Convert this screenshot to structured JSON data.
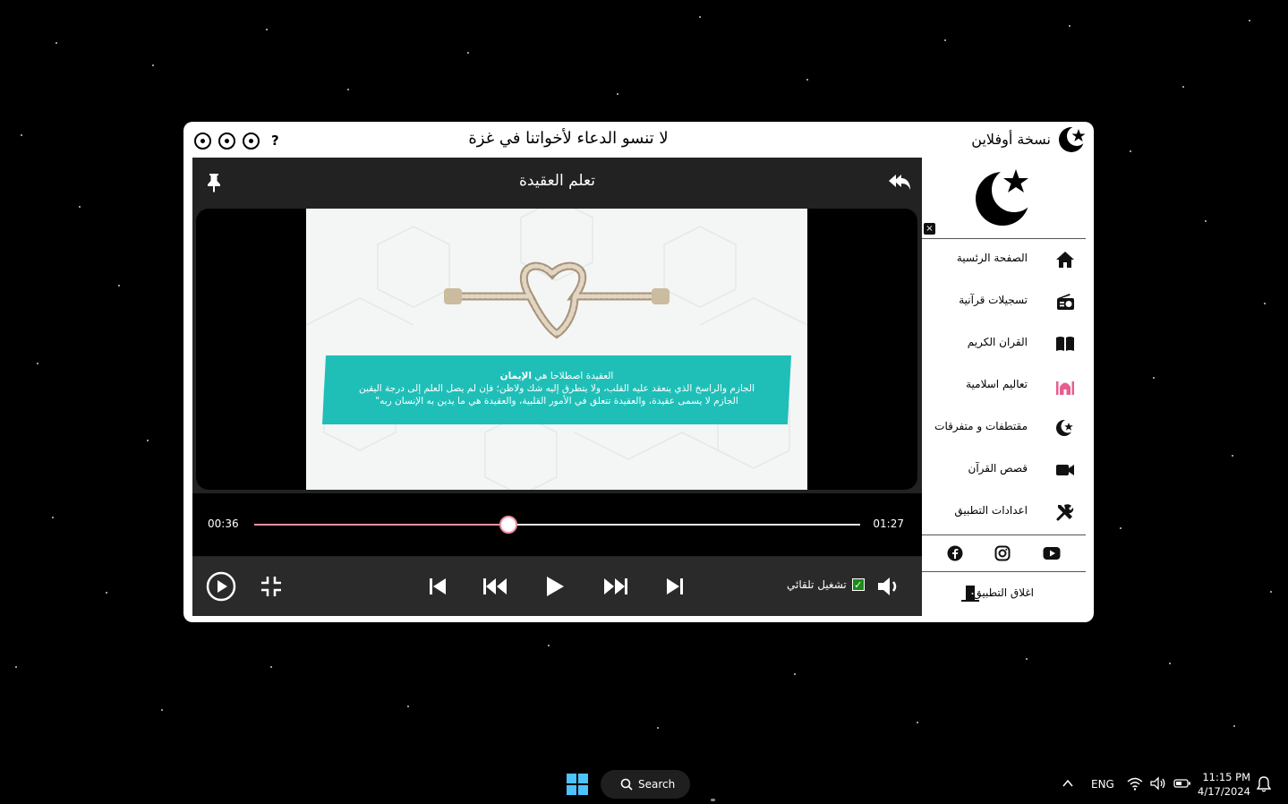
{
  "titlebar": {
    "help_label": "?",
    "announcement": "لا تنسو الدعاء لأخواتنا في غزة",
    "brand_label": "نسخة أوفلاين"
  },
  "player": {
    "page_title": "تعلم العقيدة",
    "video_caption_title_pre": "العقيدة اصطلاحا هي ",
    "video_caption_title_bold": "الإيمان",
    "video_caption_line1": "الجازم والراسخ الذي ينعقد عليه القلب، ولا  يتطرق إليه شك ولاظن؛ فإن لم يصل العلم إلى درجة اليقين",
    "video_caption_line2": "الجازم لا يسمى عقيدة، والعقيدة تتعلق في الأمور القلبية، والعقيدة هي ما يدين به الإنسان ربه\"",
    "current_time": "00:36",
    "total_time": "01:27",
    "progress": 0.42,
    "autoplay_label": "تشغيل تلقائي",
    "autoplay_checked": true,
    "accent_color": "#f28fa6"
  },
  "sidebar": {
    "close_label": "×",
    "items": [
      {
        "label": "الصفحة الرئسية",
        "icon": "home-icon"
      },
      {
        "label": "تسجيلات قرآنية",
        "icon": "radio-icon"
      },
      {
        "label": "القران الكريم",
        "icon": "book-icon"
      },
      {
        "label": "تعاليم اسلامية",
        "icon": "mosque-icon"
      },
      {
        "label": "مقتطفات و متفرقات",
        "icon": "crescent-star-icon"
      },
      {
        "label": "قصص القرآن",
        "icon": "video-camera-icon"
      },
      {
        "label": "اعدادات التطبيق",
        "icon": "tools-icon"
      }
    ],
    "quit_label": "اغلاق التطبيق"
  },
  "taskbar": {
    "search_label": "Search",
    "language": "ENG",
    "time": "11:15 PM",
    "date": "4/17/2024"
  }
}
